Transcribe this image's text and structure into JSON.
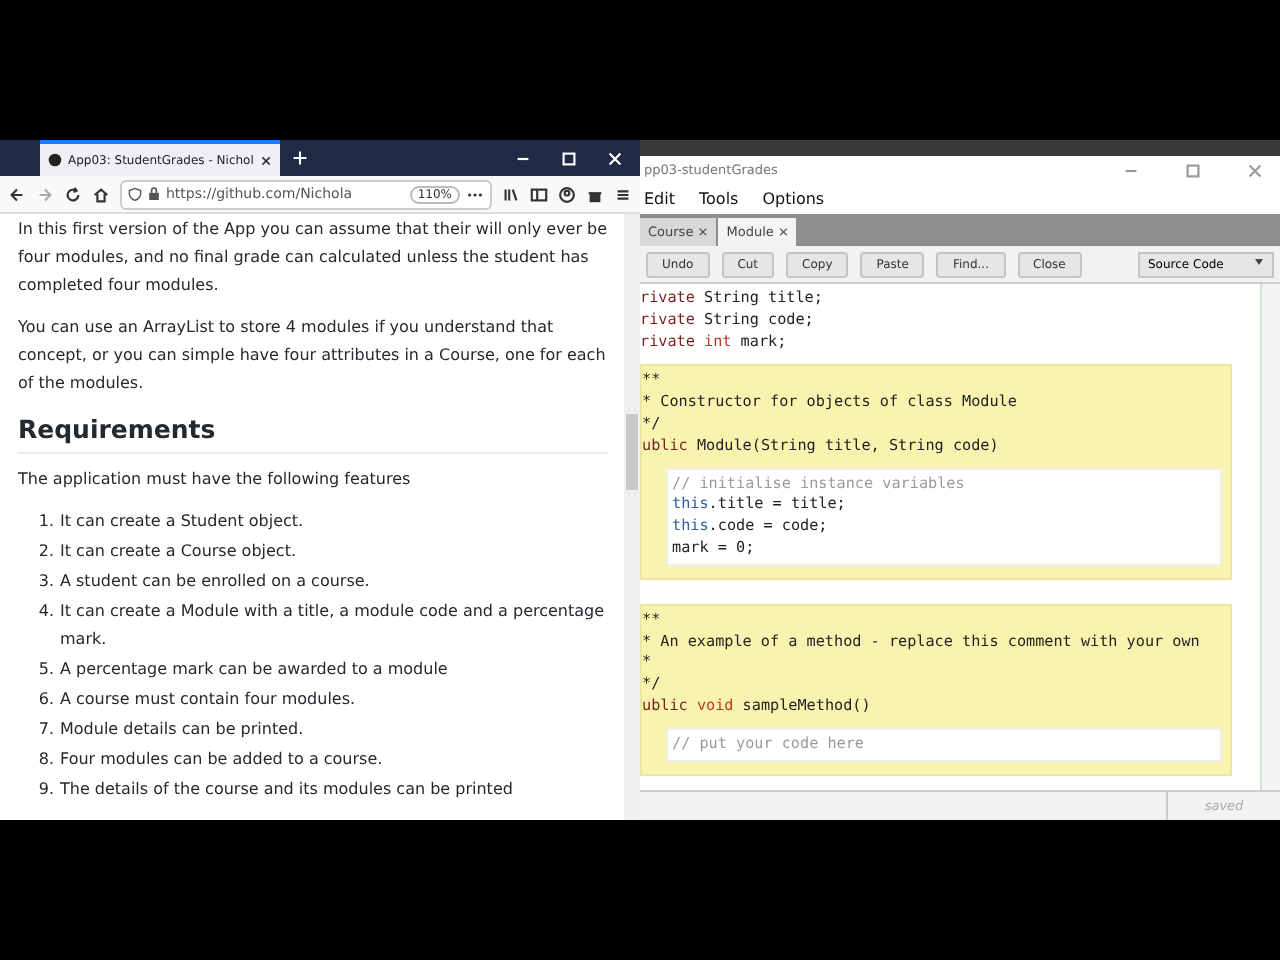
{
  "browser": {
    "tab_title": "App03: StudentGrades - Nichol",
    "url": "https://github.com/Nichola",
    "zoom": "110%",
    "paragraphs": [
      "In this first version of the App you can assume that their will only ever be four modules, and no final grade can calculated unless the student has completed four modules.",
      "You can use an ArrayList to store 4 modules if you understand that concept, or you can simple have four attributes in a Course, one for each of the modules."
    ],
    "heading": "Requirements",
    "intro": "The application must have the following features",
    "list": [
      {
        "number": "1.",
        "text": "It can create a Student object."
      },
      {
        "number": "2.",
        "text": "It can create a Course object."
      },
      {
        "number": "3.",
        "text": "A student can be enrolled on a course."
      },
      {
        "number": "4.",
        "text": "It can create a Module with a title, a module code and a percentage mark."
      },
      {
        "number": "5.",
        "text": "A percentage mark can be awarded to a module"
      },
      {
        "number": "6.",
        "text": "A course must contain four modules."
      },
      {
        "number": "7.",
        "text": "Module details can be printed."
      },
      {
        "number": "8.",
        "text": "Four modules can be added to a course."
      },
      {
        "number": "9.",
        "text": "The details of the course and its modules can be printed"
      }
    ]
  },
  "editor": {
    "title": "pp03-studentGrades",
    "menu": [
      "Edit",
      "Tools",
      "Options"
    ],
    "tabs": [
      {
        "label": "Course",
        "close": "×",
        "selected": false
      },
      {
        "label": "Module",
        "close": "×",
        "selected": true
      }
    ],
    "toolbar": [
      "Undo",
      "Cut",
      "Copy",
      "Paste",
      "Find...",
      "Close"
    ],
    "view": "Source Code",
    "fields": [
      [
        {
          "text": "rivate ",
          "kind": "keyword"
        },
        {
          "text": "String title;",
          "kind": "plain"
        }
      ],
      [
        {
          "text": "rivate ",
          "kind": "keyword"
        },
        {
          "text": "String code;",
          "kind": "plain"
        }
      ],
      [
        {
          "text": "rivate ",
          "kind": "keyword"
        },
        {
          "text": "int",
          "kind": "type"
        },
        {
          "text": " mark;",
          "kind": "plain"
        }
      ]
    ],
    "blocks": [
      {
        "header": [
          [
            {
              "text": "**",
              "kind": "plain"
            }
          ],
          [
            {
              "text": "* Constructor for objects of class Module",
              "kind": "plain"
            }
          ],
          [
            {
              "text": "*/",
              "kind": "plain"
            }
          ],
          [
            {
              "text": "ublic ",
              "kind": "keyword"
            },
            {
              "text": "Module(String title, String code)",
              "kind": "plain"
            }
          ]
        ],
        "body": [
          [
            {
              "text": "// initialise instance variables",
              "kind": "comment"
            }
          ],
          [
            {
              "text": "this",
              "kind": "this"
            },
            {
              "text": ".title = title;",
              "kind": "plain"
            }
          ],
          [
            {
              "text": "this",
              "kind": "this"
            },
            {
              "text": ".code = code;",
              "kind": "plain"
            }
          ],
          [
            {
              "text": "mark = 0;",
              "kind": "plain"
            }
          ]
        ]
      },
      {
        "header": [
          [
            {
              "text": "**",
              "kind": "plain"
            }
          ],
          [
            {
              "text": "* An example of a method - replace this comment with your own",
              "kind": "plain"
            }
          ],
          [
            {
              "text": "*",
              "kind": "plain"
            }
          ],
          [
            {
              "text": "*/",
              "kind": "plain"
            }
          ],
          [
            {
              "text": "ublic ",
              "kind": "keyword"
            },
            {
              "text": "void",
              "kind": "type"
            },
            {
              "text": " sampleMethod()",
              "kind": "plain"
            }
          ]
        ],
        "body": [
          [
            {
              "text": "// put your code here",
              "kind": "comment"
            }
          ]
        ]
      }
    ],
    "status": "saved"
  }
}
